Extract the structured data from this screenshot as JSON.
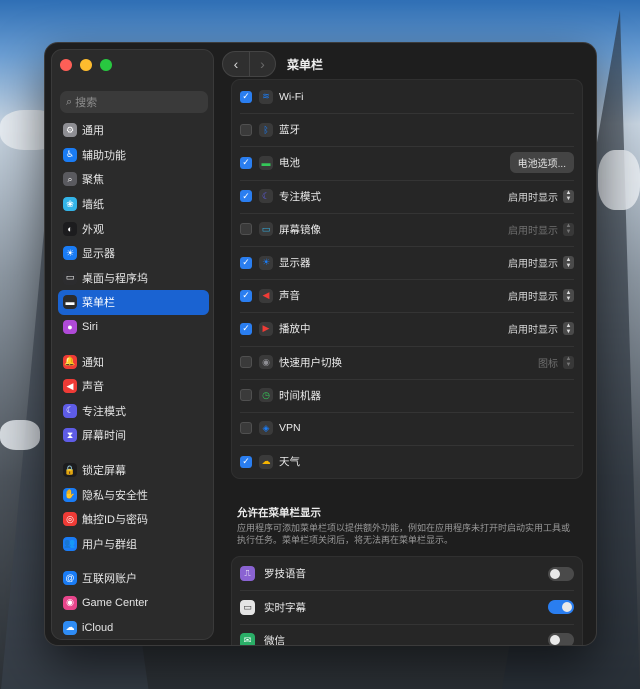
{
  "window": {
    "title": "菜单栏"
  },
  "search": {
    "placeholder": "搜索"
  },
  "sidebar": {
    "group1": [
      {
        "label": "通用",
        "icon": "gear-icon",
        "color": "#8e8e93"
      },
      {
        "label": "辅助功能",
        "icon": "accessibility-icon",
        "color": "#1a7cf5"
      },
      {
        "label": "聚焦",
        "icon": "spotlight-icon",
        "color": "#5a5a5f"
      },
      {
        "label": "墙纸",
        "icon": "wallpaper-icon",
        "color": "#33b4e8"
      },
      {
        "label": "外观",
        "icon": "appearance-icon",
        "color": "#1c1c1e"
      },
      {
        "label": "显示器",
        "icon": "display-icon",
        "color": "#1a7cf5"
      },
      {
        "label": "桌面与程序坞",
        "icon": "dock-icon",
        "color": "#2c2c2e"
      },
      {
        "label": "菜单栏",
        "icon": "menubar-icon",
        "color": "#2c2c2e",
        "selected": true
      },
      {
        "label": "Siri",
        "icon": "siri-icon",
        "color": "#b04ad8"
      }
    ],
    "group2": [
      {
        "label": "通知",
        "icon": "bell-icon",
        "color": "#ef3b36"
      },
      {
        "label": "声音",
        "icon": "speaker-icon",
        "color": "#ef3b36"
      },
      {
        "label": "专注模式",
        "icon": "moon-icon",
        "color": "#5e5ce6"
      },
      {
        "label": "屏幕时间",
        "icon": "hourglass-icon",
        "color": "#5e5ce6"
      }
    ],
    "group3": [
      {
        "label": "锁定屏幕",
        "icon": "lock-icon",
        "color": "#1c1c1e"
      },
      {
        "label": "隐私与安全性",
        "icon": "hand-icon",
        "color": "#1a7cf5"
      },
      {
        "label": "触控ID与密码",
        "icon": "fingerprint-icon",
        "color": "#ef3b36"
      },
      {
        "label": "用户与群组",
        "icon": "users-icon",
        "color": "#1a7cf5"
      }
    ],
    "group4": [
      {
        "label": "互联网账户",
        "icon": "at-icon",
        "color": "#1a7cf5"
      },
      {
        "label": "Game Center",
        "icon": "gamecenter-icon",
        "color": "#e8458b"
      },
      {
        "label": "iCloud",
        "icon": "cloud-icon",
        "color": "#2f8cf4"
      }
    ]
  },
  "menu_items": [
    {
      "label": "Wi-Fi",
      "checked": true,
      "icon": "wifi-icon",
      "icon_color": "#1a7cf5",
      "control": "none"
    },
    {
      "label": "蓝牙",
      "checked": false,
      "icon": "bluetooth-icon",
      "icon_color": "#1a7cf5",
      "control": "none"
    },
    {
      "label": "电池",
      "checked": true,
      "icon": "battery-icon",
      "icon_color": "#34c759",
      "control": "button",
      "control_label": "电池选项..."
    },
    {
      "label": "专注模式",
      "checked": true,
      "icon": "moon-icon",
      "icon_color": "#5e5ce6",
      "control": "popup",
      "control_label": "启用时显示"
    },
    {
      "label": "屏幕镜像",
      "checked": false,
      "icon": "screen-mirroring-icon",
      "icon_color": "#33b4e8",
      "control": "popup-dim",
      "control_label": "启用时显示"
    },
    {
      "label": "显示器",
      "checked": true,
      "icon": "brightness-icon",
      "icon_color": "#1a7cf5",
      "control": "popup",
      "control_label": "启用时显示"
    },
    {
      "label": "声音",
      "checked": true,
      "icon": "speaker-icon",
      "icon_color": "#ef3b36",
      "control": "popup",
      "control_label": "启用时显示"
    },
    {
      "label": "播放中",
      "checked": true,
      "icon": "play-icon",
      "icon_color": "#ef3b36",
      "control": "popup",
      "control_label": "启用时显示"
    },
    {
      "label": "快速用户切换",
      "checked": false,
      "icon": "user-switch-icon",
      "icon_color": "#8e8e93",
      "control": "popup-dim",
      "control_label": "图标"
    },
    {
      "label": "时间机器",
      "checked": false,
      "icon": "time-machine-icon",
      "icon_color": "#34c759",
      "control": "none"
    },
    {
      "label": "VPN",
      "checked": false,
      "icon": "vpn-icon",
      "icon_color": "#1a7cf5",
      "control": "none"
    },
    {
      "label": "天气",
      "checked": true,
      "icon": "weather-icon",
      "icon_color": "#f5b400",
      "control": "none"
    }
  ],
  "allow_section": {
    "title": "允许在菜单栏显示",
    "description": "应用程序可添加菜单栏项以提供额外功能，例如在应用程序未打开时启动实用工具或执行任务。菜单栏项关闭后，将无法再在菜单栏显示。",
    "apps": [
      {
        "label": "罗技语音",
        "enabled": false,
        "icon": "logi-voice-icon",
        "icon_color": "#8a63d2"
      },
      {
        "label": "实时字幕",
        "enabled": true,
        "icon": "live-captions-icon",
        "icon_color": "#e5e5e5"
      },
      {
        "label": "微信",
        "enabled": false,
        "icon": "wechat-icon",
        "icon_color": "#2aae67"
      }
    ]
  },
  "colors": {
    "accent": "#1a63d2",
    "checkbox": "#2a7ef0"
  }
}
